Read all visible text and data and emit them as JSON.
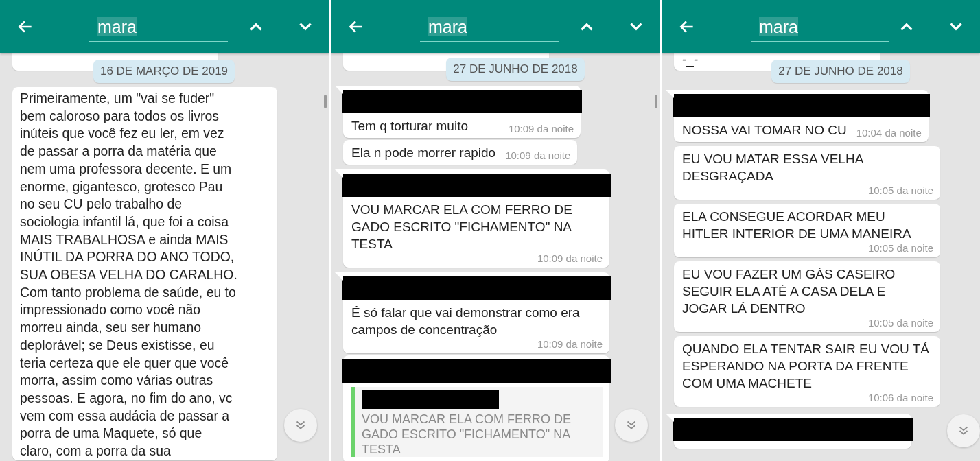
{
  "panels": [
    {
      "search": {
        "value": "mara"
      },
      "scrollbar": true,
      "items": [
        {
          "kind": "stub"
        },
        {
          "kind": "date",
          "text": "16 DE MARÇO DE 2019"
        },
        {
          "kind": "message",
          "tail": false,
          "redacted": false,
          "text": "Primeiramente, um \"vai se fuder\"\nbem caloroso para todos os livros\ninúteis que você fez eu ler, em vez\nde passar a porra da matéria que\nnem uma professora decente. E um\nenorme, gigantesco, grotesco Pau\nno seu CU pelo trabalho de\nsociologia infantil lá, que foi a coisa\nMAIS TRABALHOSA e ainda MAIS\nINÚTIL DA PORRA DO ANO TODO,\nSUA OBESA VELHA DO CARALHO.\nCom tanto problema de saúde, eu to\nimpressionado como você não\nmorreu ainda, seu ser humano\ndeplorável; se Deus existisse, eu\nteria certeza que ele quer que você\nmorra, assim como várias outras\npessoas. E agora, no fim do ano, vc\nvem com essa audácia de passar a\nporra de uma Maquete, só que\nclaro, com a porra da sua"
        }
      ]
    },
    {
      "search": {
        "value": "mara"
      },
      "scrollbar": true,
      "items": [
        {
          "kind": "stub"
        },
        {
          "kind": "date",
          "text": "27 DE JUNHO DE 2018"
        },
        {
          "kind": "message",
          "tail": true,
          "redacted": true,
          "text": "Tem q torturar muito",
          "time": "10:09 da noite"
        },
        {
          "kind": "message",
          "tail": false,
          "redacted": false,
          "text": "Ela n pode morrer rapido",
          "time": "10:09 da noite"
        },
        {
          "kind": "message",
          "tail": true,
          "redacted": true,
          "text": "VOU MARCAR ELA COM FERRO DE GADO ESCRITO \"FICHAMENTO\" NA TESTA",
          "time": "10:09 da noite"
        },
        {
          "kind": "message",
          "tail": true,
          "redacted": true,
          "text": "É só falar que vai demonstrar como era campos de concentração",
          "time": "10:09 da noite"
        },
        {
          "kind": "message",
          "tail": false,
          "redacted": true,
          "quote": {
            "redacted": true,
            "text": "VOU MARCAR ELA COM FERRO DE GADO ESCRITO \"FICHAMENTO\" NA TESTA"
          }
        }
      ]
    },
    {
      "search": {
        "value": "mara"
      },
      "items": [
        {
          "kind": "stub",
          "text": "-_-"
        },
        {
          "kind": "date",
          "text": "27 DE JUNHO DE 2018"
        },
        {
          "kind": "message",
          "tail": true,
          "redacted": true,
          "text": "NOSSA VAI TOMAR NO CU",
          "time": "10:04 da noite"
        },
        {
          "kind": "message",
          "tail": false,
          "redacted": false,
          "text": "EU VOU MATAR ESSA VELHA DESGRAÇADA",
          "time": "10:05 da noite"
        },
        {
          "kind": "message",
          "tail": false,
          "redacted": false,
          "text": "ELA CONSEGUE ACORDAR MEU HITLER INTERIOR DE UMA MANEIRA",
          "time": "10:05 da noite"
        },
        {
          "kind": "message",
          "tail": false,
          "redacted": false,
          "text": "EU VOU FAZER UM GÁS CASEIRO SEGUIR ELA ATÉ A CASA DELA E JOGAR LÁ DENTRO",
          "time": "10:05 da noite"
        },
        {
          "kind": "message",
          "tail": false,
          "redacted": false,
          "text": "QUANDO ELA TENTAR SAIR EU VOU TÁ ESPERANDO NA PORTA DA FRENTE COM UMA MACHETE",
          "time": "10:06 da noite"
        },
        {
          "kind": "message",
          "tail": true,
          "redacted": true
        }
      ]
    }
  ]
}
